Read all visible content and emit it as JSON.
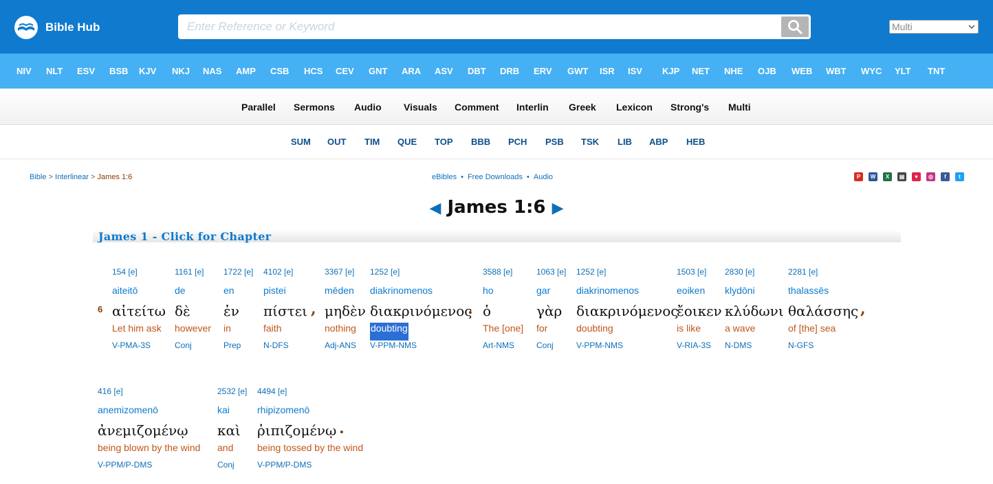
{
  "header": {
    "logo_text": "Bible Hub",
    "search_placeholder": "Enter Reference or Keyword",
    "select_value": "Multi"
  },
  "versions": [
    "NIV",
    "NLT",
    "ESV",
    "BSB",
    "KJV",
    "NKJ",
    "NAS",
    "AMP",
    "CSB",
    "HCS",
    "CEV",
    "GNT",
    "ARA",
    "ASV",
    "DBT",
    "DRB",
    "ERV",
    "GWT",
    "ISR",
    "ISV",
    "KJP",
    "NET",
    "NHE",
    "OJB",
    "WEB",
    "WBT",
    "WYC",
    "YLT",
    "TNT"
  ],
  "nav2": [
    "Parallel",
    "Sermons",
    "Audio",
    "Visuals",
    "Comment",
    "Interlin",
    "Greek",
    "Lexicon",
    "Strong's",
    "Multi"
  ],
  "nav3": [
    "SUM",
    "OUT",
    "TIM",
    "QUE",
    "TOP",
    "BBB",
    "PCH",
    "PSB",
    "TSK",
    "LIB",
    "ABP",
    "HEB"
  ],
  "breadcrumb": {
    "bible": "Bible",
    "sep1": " > ",
    "interlinear": "Interlinear",
    "sep2": " > ",
    "current": "James 1:6"
  },
  "mid_links": [
    "eBibles",
    "Free Downloads",
    "Audio"
  ],
  "share_icons": [
    "pdf-icon",
    "word-icon",
    "excel-icon",
    "print-icon",
    "pocket-icon",
    "instagram-icon",
    "facebook-icon",
    "twitter-icon"
  ],
  "title": {
    "prev_arrow": "◀",
    "text": "James 1:6",
    "next_arrow": "▶"
  },
  "chapter_link": "James 1 - Click for Chapter",
  "verse_number": "6",
  "words": [
    {
      "strong": "154 [e]",
      "translit": "aiteitō",
      "greek": "αἰτείτω",
      "eng": "Let him ask",
      "parse": "V-PMA-3S"
    },
    {
      "strong": "1161 [e]",
      "translit": "de",
      "greek": "δὲ",
      "eng": "however",
      "parse": "Conj"
    },
    {
      "strong": "1722 [e]",
      "translit": "en",
      "greek": "ἐν",
      "eng": "in",
      "parse": "Prep"
    },
    {
      "strong": "4102 [e]",
      "translit": "pistei",
      "greek": "πίστει",
      "eng": "faith",
      "parse": "N-DFS"
    },
    {
      "strong": "3367 [e]",
      "translit": "mēden",
      "greek": "μηδὲν",
      "eng": "nothing",
      "parse": "Adj-ANS"
    },
    {
      "strong": "1252 [e]",
      "translit": "diakrinomenos",
      "greek": "διακρινόμενος",
      "eng": "doubting",
      "parse": "V-PPM-NMS"
    },
    {
      "strong": "3588 [e]",
      "translit": "ho",
      "greek": "ὁ",
      "eng": "The [one]",
      "parse": "Art-NMS"
    },
    {
      "strong": "1063 [e]",
      "translit": "gar",
      "greek": "γὰρ",
      "eng": "for",
      "parse": "Conj"
    },
    {
      "strong": "1252 [e]",
      "translit": "diakrinomenos",
      "greek": "διακρινόμενος",
      "eng": "doubting",
      "parse": "V-PPM-NMS"
    },
    {
      "strong": "1503 [e]",
      "translit": "eoiken",
      "greek": "ἔοικεν",
      "eng": "is like",
      "parse": "V-RIA-3S"
    },
    {
      "strong": "2830 [e]",
      "translit": "klydōni",
      "greek": "κλύδωνι",
      "eng": "a wave",
      "parse": "N-DMS"
    },
    {
      "strong": "2281 [e]",
      "translit": "thalassēs",
      "greek": "θαλάσσης",
      "eng": "of [the] sea",
      "parse": "N-GFS"
    },
    {
      "strong": "416 [e]",
      "translit": "anemizomenō",
      "greek": "ἀνεμιζομένῳ",
      "eng": "being blown by the wind",
      "parse": "V-PPM/P-DMS"
    },
    {
      "strong": "2532 [e]",
      "translit": "kai",
      "greek": "καὶ",
      "eng": "and",
      "parse": "Conj"
    },
    {
      "strong": "4494 [e]",
      "translit": "rhipizomenō",
      "greek": "ῥιπιζομένῳ",
      "eng": "being tossed by the wind",
      "parse": "V-PPM/P-DMS"
    }
  ],
  "punct": {
    "comma": ",",
    "period": "."
  },
  "colors": {
    "header_bg": "#0f7ace",
    "version_bar": "#45b0f4",
    "link_blue": "#0e6fb8",
    "english_orange": "#c0561a",
    "verse_brown": "#8b3a00"
  }
}
